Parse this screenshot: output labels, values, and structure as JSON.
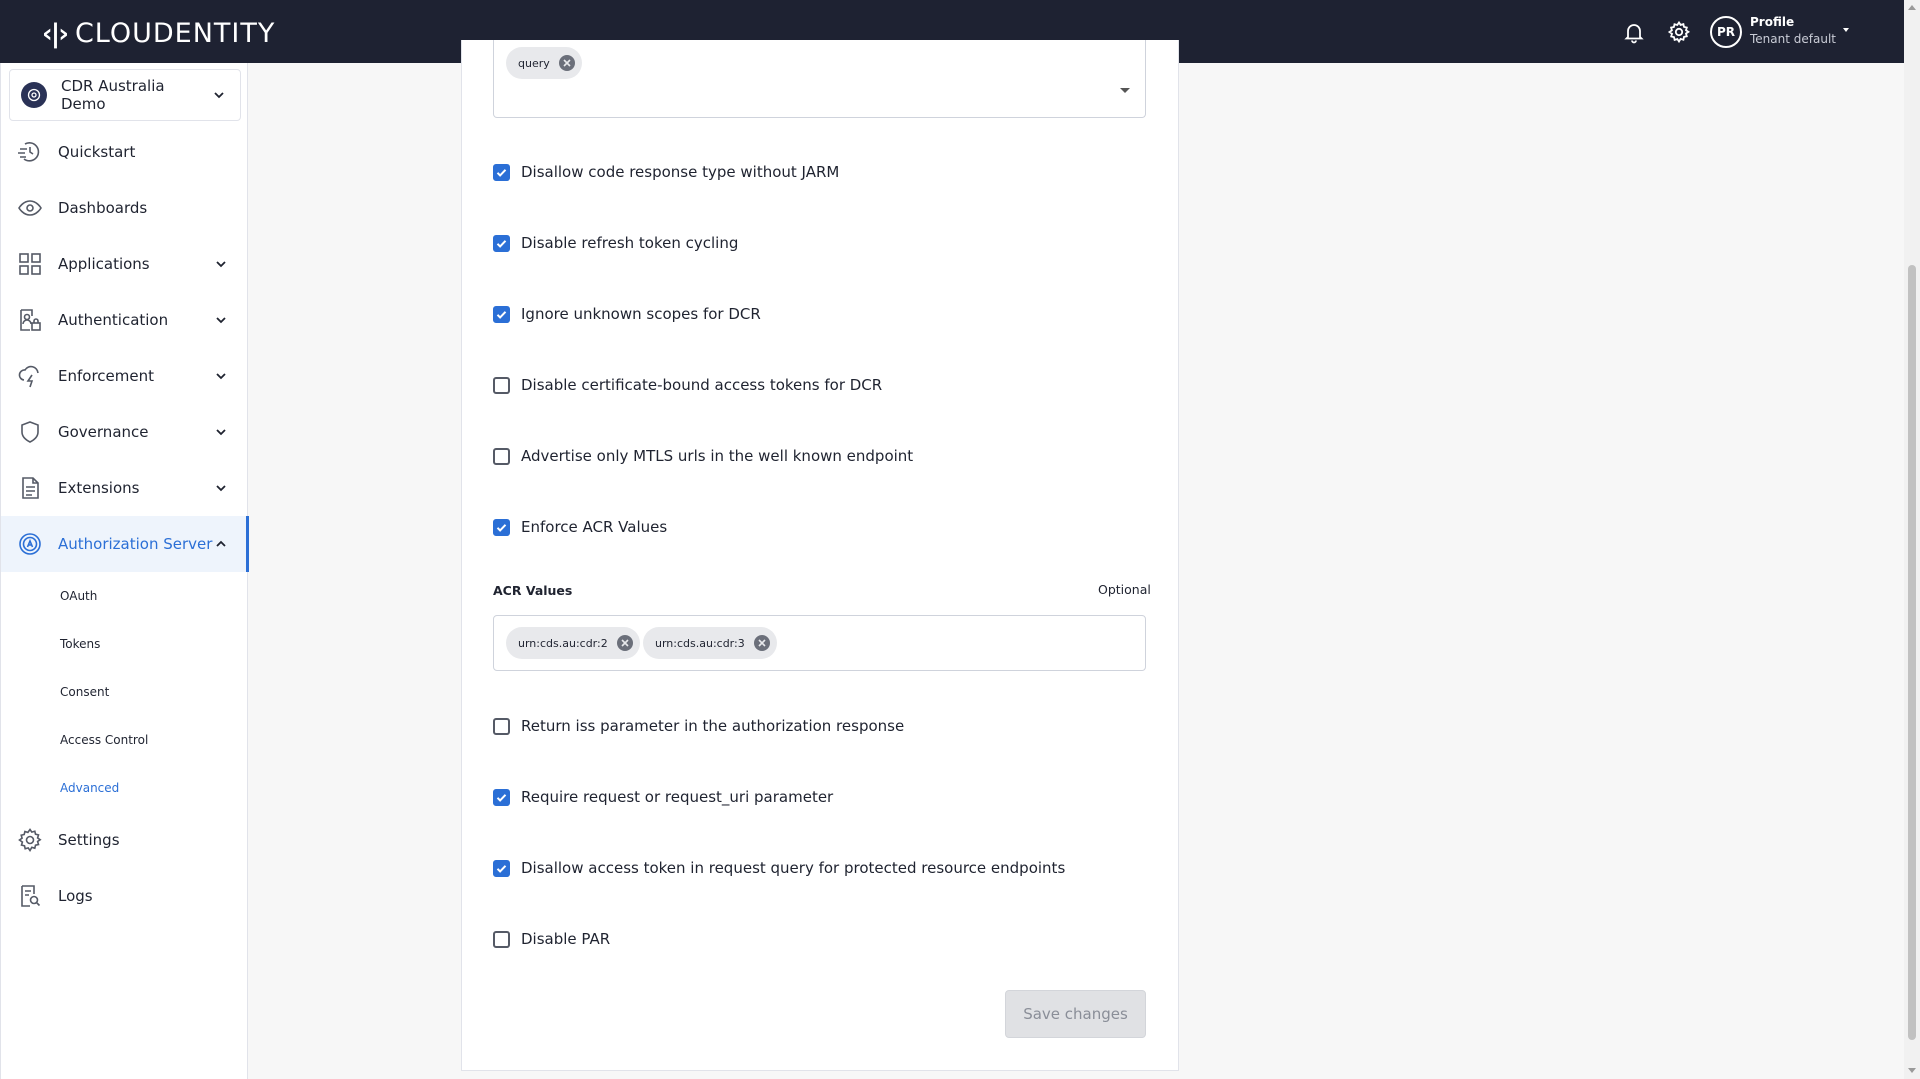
{
  "app": {
    "logo_text": "CLOUDENTITY",
    "profile_initials": "PR",
    "profile_name": "Profile",
    "tenant_label": "Tenant default"
  },
  "sidebar": {
    "workspace": "CDR Australia Demo",
    "items": [
      {
        "label": "Quickstart",
        "icon": "quickstart-icon"
      },
      {
        "label": "Dashboards",
        "icon": "eye-icon"
      },
      {
        "label": "Applications",
        "icon": "grid-icon"
      },
      {
        "label": "Authentication",
        "icon": "user-lock-icon"
      },
      {
        "label": "Enforcement",
        "icon": "lightning-cloud-icon"
      },
      {
        "label": "Governance",
        "icon": "shield-icon"
      },
      {
        "label": "Extensions",
        "icon": "document-icon"
      },
      {
        "label": "Authorization Server",
        "icon": "server-a-icon"
      },
      {
        "label": "Settings",
        "icon": "gear-icon"
      },
      {
        "label": "Logs",
        "icon": "logs-search-icon"
      }
    ],
    "subitems": [
      "OAuth",
      "Tokens",
      "Consent",
      "Access Control",
      "Advanced"
    ],
    "active_item": "Authorization Server",
    "active_subitem": "Advanced"
  },
  "form": {
    "response_modes_chip": "query",
    "options": [
      {
        "label": "Disallow code response type without JARM",
        "checked": true
      },
      {
        "label": "Disable refresh token cycling",
        "checked": true
      },
      {
        "label": "Ignore unknown scopes for DCR",
        "checked": true
      },
      {
        "label": "Disable certificate-bound access tokens for DCR",
        "checked": false
      },
      {
        "label": "Advertise only MTLS urls in the well known endpoint",
        "checked": false
      },
      {
        "label": "Enforce ACR Values",
        "checked": true
      },
      {
        "label": "Return iss parameter in the authorization response",
        "checked": false
      },
      {
        "label": "Require request or request_uri parameter",
        "checked": true
      },
      {
        "label": "Disallow access token in request query for protected resource endpoints",
        "checked": true
      },
      {
        "label": "Disable PAR",
        "checked": false
      }
    ],
    "acr_label": "ACR Values",
    "acr_optional": "Optional",
    "acr_values": [
      "urn:cds.au:cdr:2",
      "urn:cds.au:cdr:3"
    ],
    "save_label": "Save changes"
  },
  "colors": {
    "topbar": "#1e2232",
    "accent": "#2b6fd6"
  }
}
